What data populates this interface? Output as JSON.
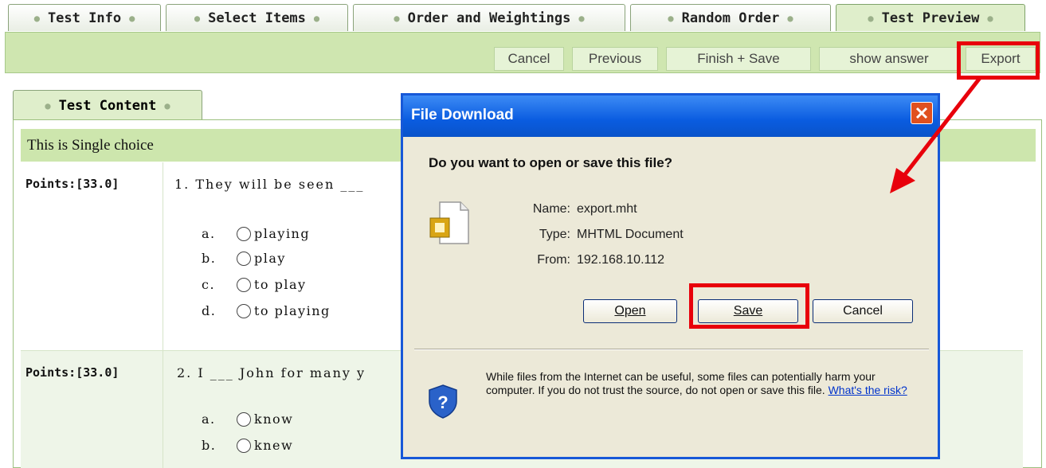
{
  "tabs": [
    {
      "label": "Test Info"
    },
    {
      "label": "Select Items"
    },
    {
      "label": "Order and Weightings"
    },
    {
      "label": "Random Order"
    },
    {
      "label": "Test Preview"
    }
  ],
  "toolbar": {
    "cancel": "Cancel",
    "previous": "Previous",
    "finish_save": "Finish + Save",
    "show_answer": "show answer",
    "export": "Export"
  },
  "inner_tab": {
    "label": "Test Content"
  },
  "section": {
    "title": "This is Single choice"
  },
  "questions": [
    {
      "points": "Points:[33.0]",
      "text": "1. They will be seen ___",
      "options": [
        {
          "letter": "a.",
          "text": "playing"
        },
        {
          "letter": "b.",
          "text": "play"
        },
        {
          "letter": "c.",
          "text": "to play"
        },
        {
          "letter": "d.",
          "text": "to playing"
        }
      ]
    },
    {
      "points": "Points:[33.0]",
      "text": "2. I ___ John for many y",
      "options": [
        {
          "letter": "a.",
          "text": "know"
        },
        {
          "letter": "b.",
          "text": "knew"
        }
      ]
    }
  ],
  "dialog": {
    "title": "File Download",
    "question": "Do you want to open or save this file?",
    "name_label": "Name:",
    "name_value": "export.mht",
    "type_label": "Type:",
    "type_value": "MHTML Document",
    "from_label": "From:",
    "from_value": "192.168.10.112",
    "open_button": "Open",
    "save_button": "Save",
    "cancel_button": "Cancel",
    "warning": "While files from the Internet can be useful, some files can potentially harm your computer. If you do not trust the source, do not open or save this file.",
    "risk_link": "What's the risk?"
  },
  "colors": {
    "highlight": "#e8000b",
    "toolbar_bg": "#cfe6b0",
    "titlebar": "#0a5ce0"
  }
}
